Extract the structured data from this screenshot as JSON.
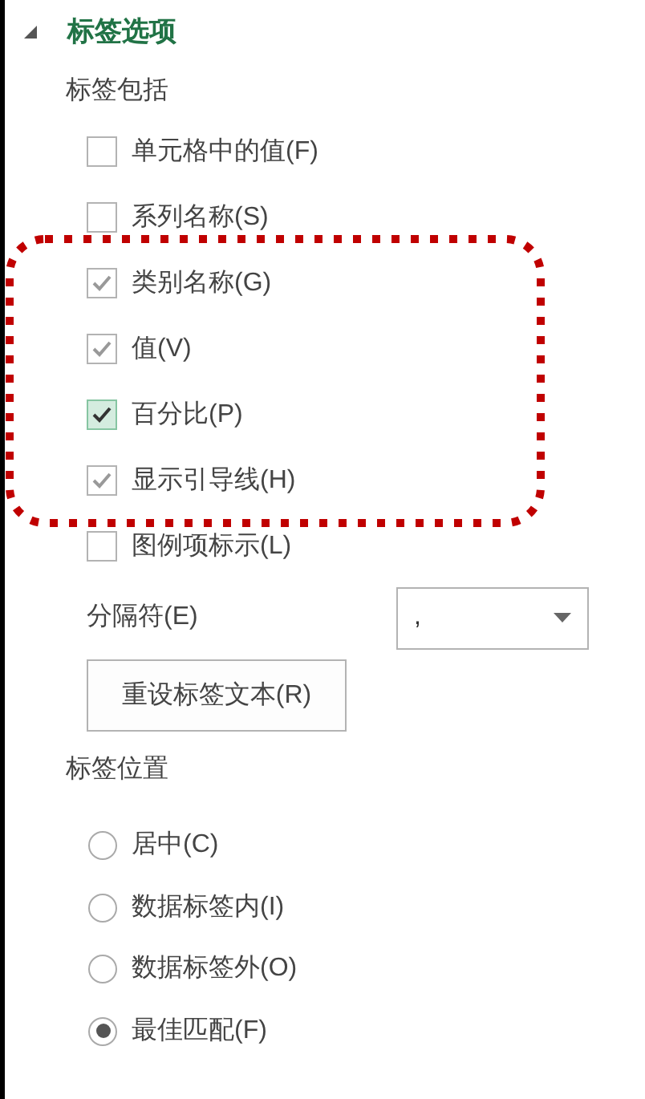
{
  "section": {
    "title": "标签选项",
    "expanded": true
  },
  "include_heading": "标签包括",
  "checkboxes": [
    {
      "label": "单元格中的值(F)",
      "checked": false,
      "focused": false,
      "highlighted": false
    },
    {
      "label": "系列名称(S)",
      "checked": false,
      "focused": false,
      "highlighted": false
    },
    {
      "label": "类别名称(G)",
      "checked": true,
      "focused": false,
      "highlighted": true
    },
    {
      "label": "值(V)",
      "checked": true,
      "focused": false,
      "highlighted": true
    },
    {
      "label": "百分比(P)",
      "checked": true,
      "focused": true,
      "highlighted": true
    },
    {
      "label": "显示引导线(H)",
      "checked": true,
      "focused": false,
      "highlighted": true
    },
    {
      "label": "图例项标示(L)",
      "checked": false,
      "focused": false,
      "highlighted": false
    }
  ],
  "separator": {
    "label": "分隔符(E)",
    "value": ","
  },
  "reset_button": "重设标签文本(R)",
  "position_heading": "标签位置",
  "positions": [
    {
      "label": "居中(C)",
      "selected": false
    },
    {
      "label": "数据标签内(I)",
      "selected": false
    },
    {
      "label": "数据标签外(O)",
      "selected": false
    },
    {
      "label": "最佳匹配(F)",
      "selected": true
    }
  ]
}
